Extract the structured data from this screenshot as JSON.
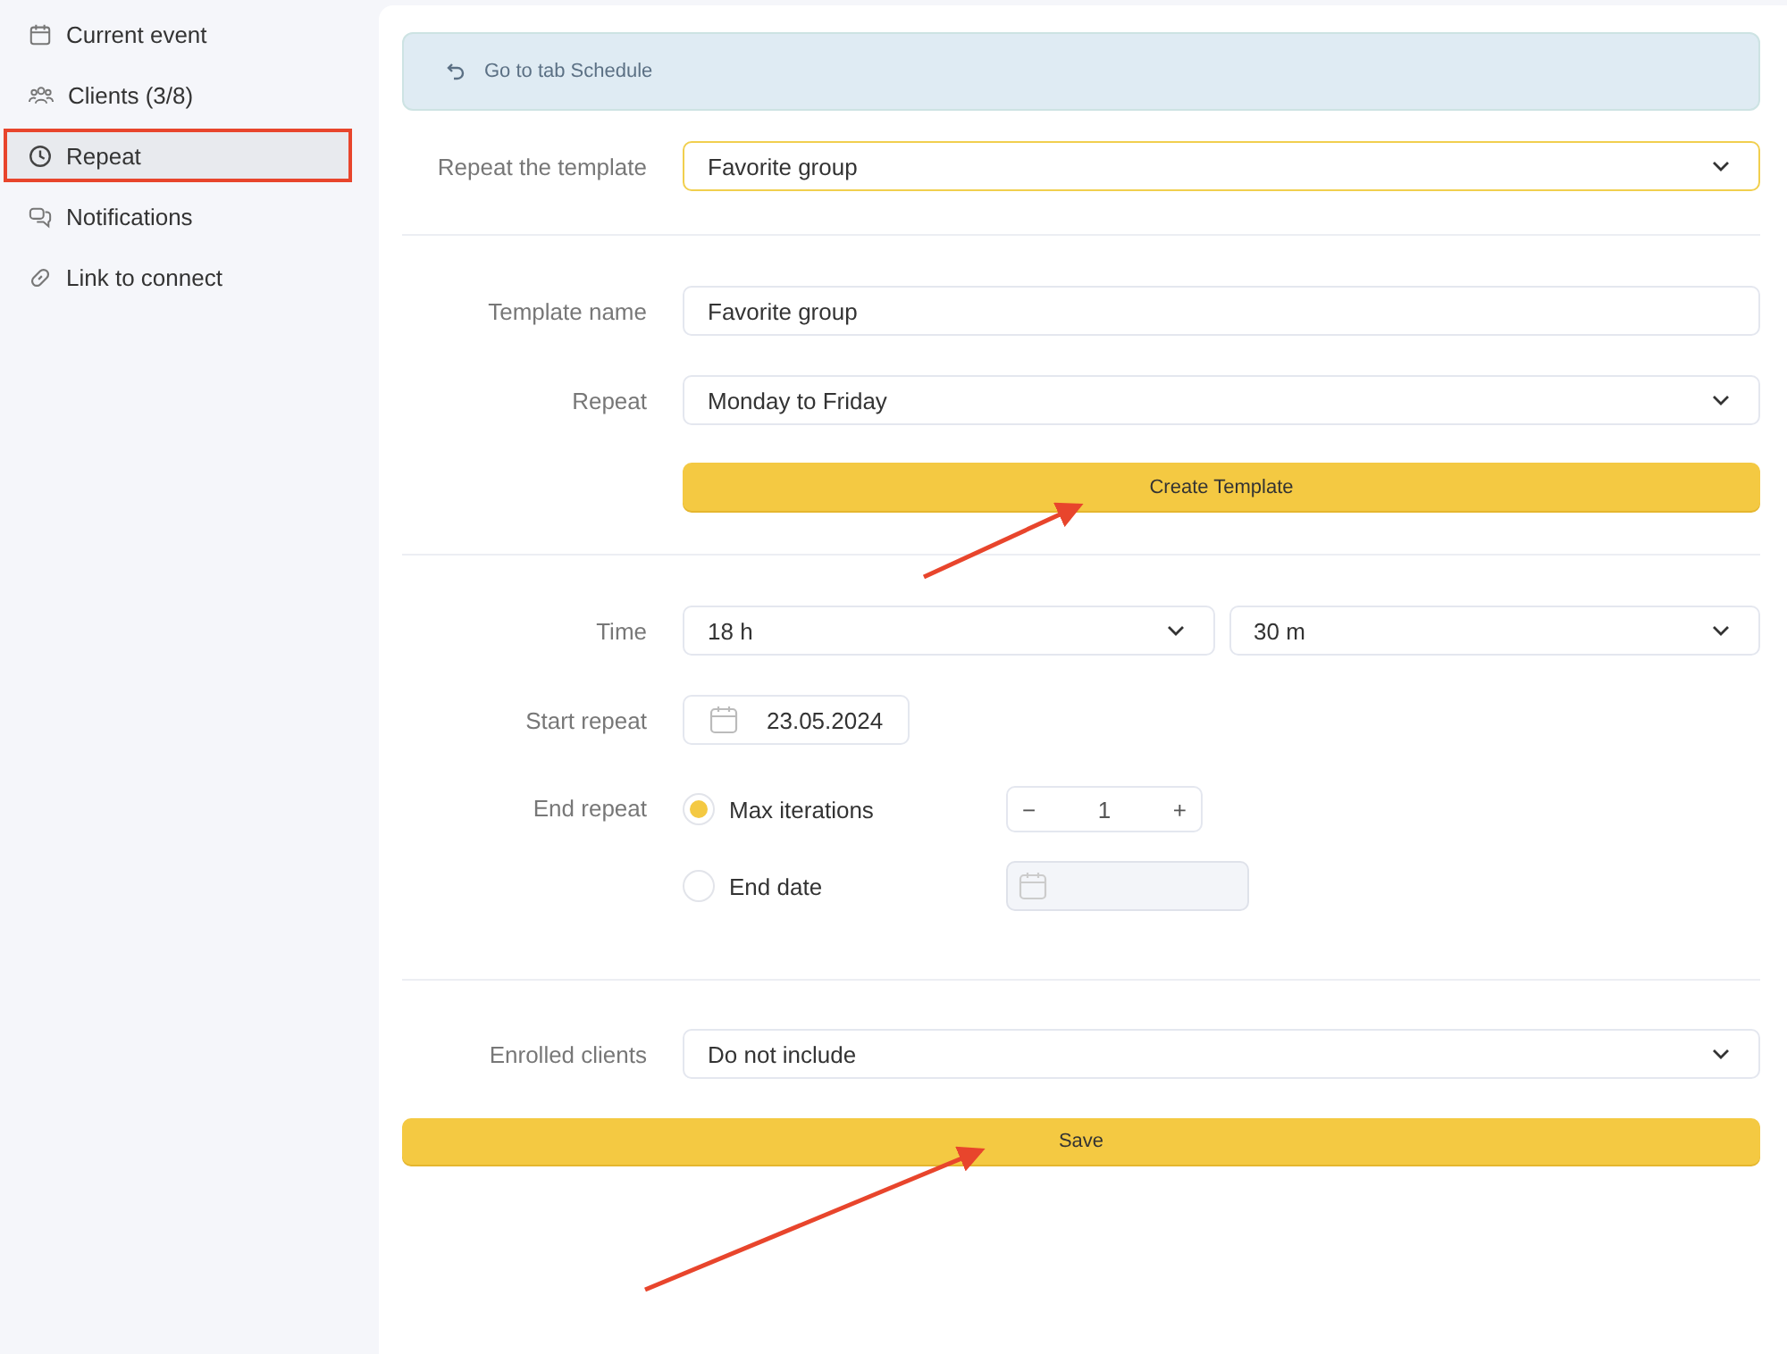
{
  "sidebar": {
    "items": [
      {
        "label": "Current event",
        "selected": false
      },
      {
        "label": "Clients (3/8)",
        "selected": false
      },
      {
        "label": "Repeat",
        "selected": true
      },
      {
        "label": "Notifications",
        "selected": false
      },
      {
        "label": "Link to connect",
        "selected": false
      }
    ]
  },
  "back_link": {
    "label": "Go to tab Schedule"
  },
  "template_select": {
    "label": "Repeat the template",
    "value": "Favorite group"
  },
  "template_name": {
    "label": "Template name",
    "value": "Favorite group"
  },
  "repeat": {
    "label": "Repeat",
    "value": "Monday to Friday"
  },
  "create_button": "Create Template",
  "time": {
    "label": "Time",
    "hours": "18 h",
    "minutes": "30 m"
  },
  "start_repeat": {
    "label": "Start repeat",
    "value": "23.05.2024"
  },
  "end_repeat": {
    "label": "End repeat",
    "options": [
      {
        "label": "Max iterations",
        "selected": true,
        "kind": "stepper",
        "value": "1",
        "minus": "−",
        "plus": "+"
      },
      {
        "label": "End date",
        "selected": false,
        "kind": "date"
      }
    ]
  },
  "enrolled_clients": {
    "label": "Enrolled clients",
    "value": "Do not include"
  },
  "save_button": "Save"
}
